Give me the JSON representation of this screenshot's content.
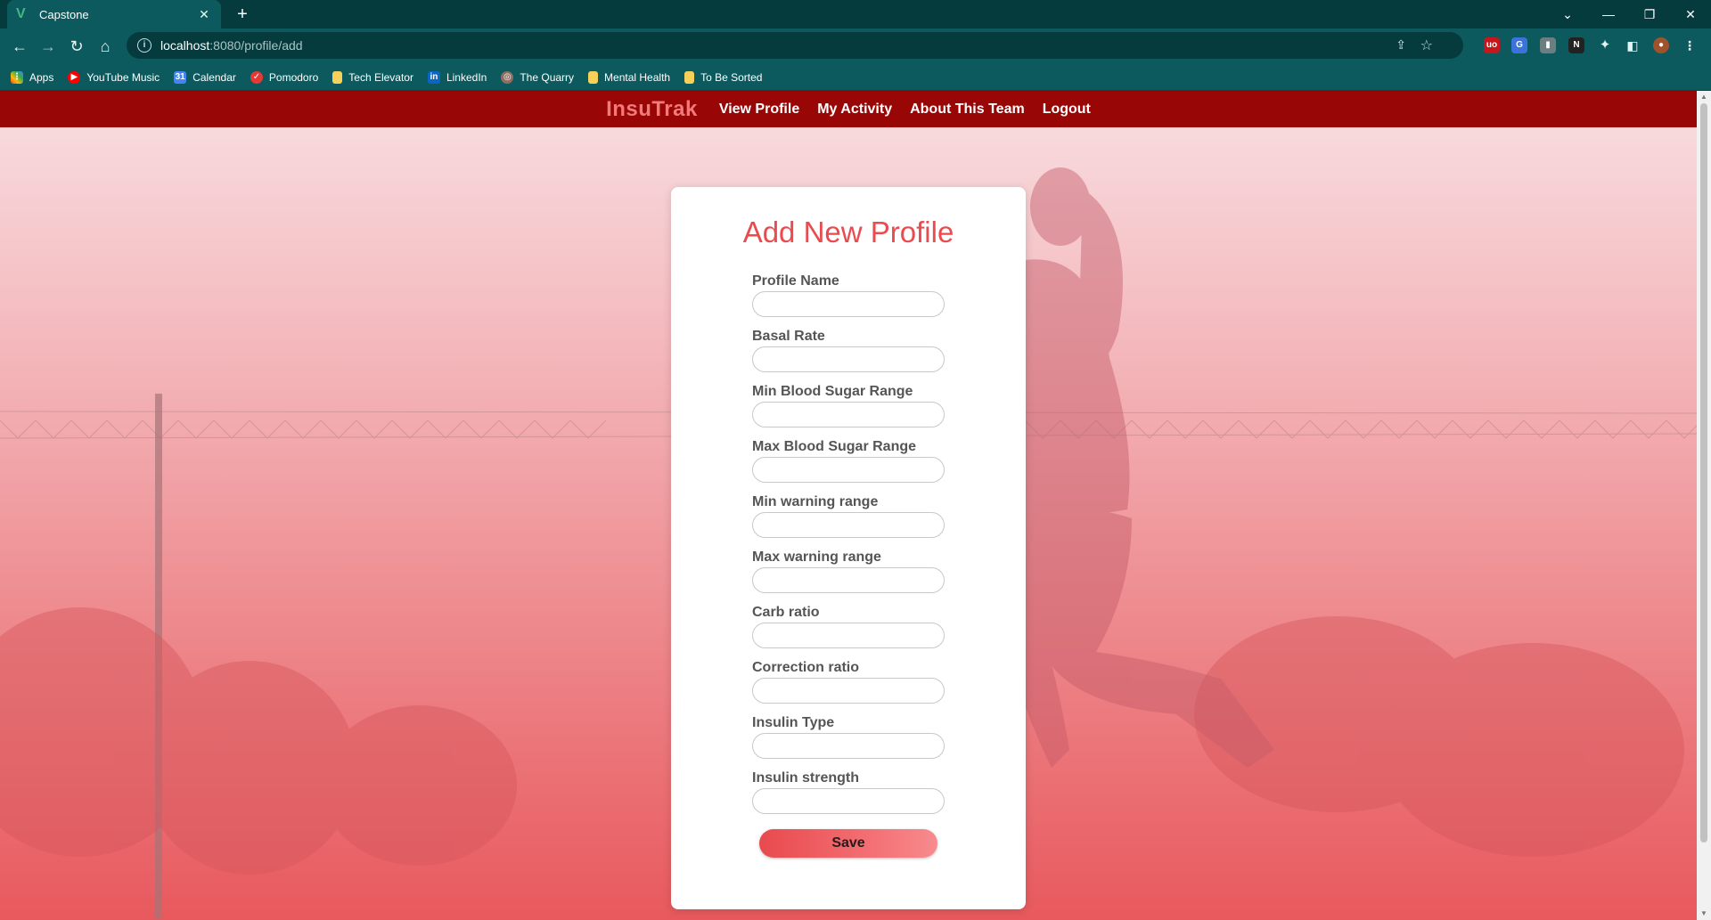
{
  "browser": {
    "tab_title": "Capstone",
    "url_host": "localhost",
    "url_path": ":8080/profile/add",
    "bookmarks": [
      {
        "label": "Apps",
        "icon": "apps-grid-icon"
      },
      {
        "label": "YouTube Music",
        "icon": "youtube-music-icon"
      },
      {
        "label": "Calendar",
        "icon": "calendar-icon"
      },
      {
        "label": "Pomodoro",
        "icon": "pomodoro-icon"
      },
      {
        "label": "Tech Elevator",
        "icon": "folder-icon"
      },
      {
        "label": "LinkedIn",
        "icon": "linkedin-icon"
      },
      {
        "label": "The Quarry",
        "icon": "quarry-icon"
      },
      {
        "label": "Mental Health",
        "icon": "folder-icon"
      },
      {
        "label": "To Be Sorted",
        "icon": "folder-icon"
      }
    ]
  },
  "navbar": {
    "brand": "InsuTrak",
    "links": [
      "View Profile",
      "My Activity",
      "About This Team",
      "Logout"
    ]
  },
  "form": {
    "title": "Add New Profile",
    "fields": [
      {
        "label": "Profile Name",
        "value": ""
      },
      {
        "label": "Basal Rate",
        "value": ""
      },
      {
        "label": "Min Blood Sugar Range",
        "value": ""
      },
      {
        "label": "Max Blood Sugar Range",
        "value": ""
      },
      {
        "label": "Min warning range",
        "value": ""
      },
      {
        "label": "Max warning range",
        "value": ""
      },
      {
        "label": "Carb ratio",
        "value": ""
      },
      {
        "label": "Correction ratio",
        "value": ""
      },
      {
        "label": "Insulin Type",
        "value": ""
      },
      {
        "label": "Insulin strength",
        "value": ""
      }
    ],
    "save_label": "Save"
  },
  "colors": {
    "navbar": "#990606",
    "brand": "#f17a7a",
    "title": "#ea4b4f",
    "button": "#e84a4e"
  }
}
